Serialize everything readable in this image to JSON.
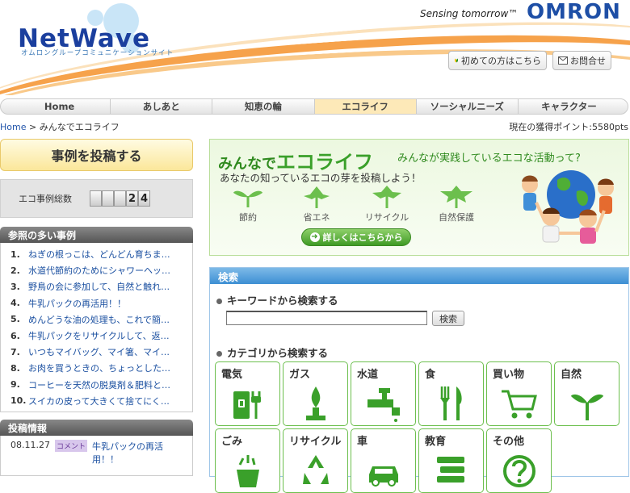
{
  "header": {
    "logo": "NetWave",
    "logo_sub": "オムロングループコミュニケーションサイト",
    "tagline": "Sensing tomorrow™",
    "brand": "OMRON",
    "btn_first": "初めての方はこちら",
    "btn_contact": "お問合せ"
  },
  "nav": {
    "items": [
      {
        "label": "Home"
      },
      {
        "label": "あしあと"
      },
      {
        "label": "知恵の輪"
      },
      {
        "label": "エコライフ"
      },
      {
        "label": "ソーシャルニーズ"
      },
      {
        "label": "キャラクター"
      }
    ],
    "active_index": 3
  },
  "breadcrumb": {
    "home": "Home",
    "sep": ">",
    "current": "みんなでエコライフ"
  },
  "points": "現在の獲得ポイント:5580pts",
  "sidebar": {
    "post_button": "事例を投稿する",
    "total_label": "エコ事例総数",
    "total_digits": [
      "",
      "",
      "",
      "2",
      "4"
    ],
    "ranking_title": "参照の多い事例",
    "ranking": [
      {
        "num": "1.",
        "text": "ねぎの根っこは、どんどん育ちま…"
      },
      {
        "num": "2.",
        "text": "水道代節約のためにシャワーヘッ…"
      },
      {
        "num": "3.",
        "text": "野鳥の会に参加して、自然と触れ…"
      },
      {
        "num": "4.",
        "text": "牛乳パックの再活用！！"
      },
      {
        "num": "5.",
        "text": "めんどうな油の処理も、これで簡…"
      },
      {
        "num": "6.",
        "text": "牛乳パックをリサイクルして、返…"
      },
      {
        "num": "7.",
        "text": "いつもマイバッグ、マイ箸、マイ…"
      },
      {
        "num": "8.",
        "text": "お肉を買うときの、ちょっとした…"
      },
      {
        "num": "9.",
        "text": "コーヒーを天然の脱臭剤＆肥料と…"
      },
      {
        "num": "10.",
        "text": "スイカの皮って大きくて捨てにく…"
      }
    ],
    "postinfo_title": "投稿情報",
    "postinfo": {
      "date": "08.11.27",
      "tag": "コメント",
      "text": "牛乳パックの再活用！！"
    }
  },
  "banner": {
    "title_pre": "みんなで",
    "title_main": "エコライフ",
    "subtitle": "みんなが実践しているエコな活動って?",
    "lead": "あなたの知っているエコの芽を投稿しよう！",
    "eco_items": [
      "節約",
      "省エネ",
      "リサイクル",
      "自然保護"
    ],
    "more": "詳しくはこちらから"
  },
  "search": {
    "title": "検索",
    "keyword_heading": "キーワードから検索する",
    "keyword_value": "",
    "button": "検索",
    "category_heading": "カテゴリから検索する",
    "categories": [
      {
        "label": "電気",
        "icon": "plug-icon"
      },
      {
        "label": "ガス",
        "icon": "flame-icon"
      },
      {
        "label": "水道",
        "icon": "faucet-icon"
      },
      {
        "label": "食",
        "icon": "fork-knife-icon"
      },
      {
        "label": "買い物",
        "icon": "cart-icon"
      },
      {
        "label": "自然",
        "icon": "sprout-icon"
      },
      {
        "label": "ごみ",
        "icon": "trash-icon"
      },
      {
        "label": "リサイクル",
        "icon": "recycle-icon"
      },
      {
        "label": "車",
        "icon": "car-icon"
      },
      {
        "label": "教育",
        "icon": "book-icon"
      },
      {
        "label": "その他",
        "icon": "question-icon"
      }
    ]
  },
  "colors": {
    "accent_green": "#3aa02a",
    "nav_active": "#fde9b8",
    "link_blue": "#1a4fa0",
    "search_blue": "#3d8fd3"
  }
}
